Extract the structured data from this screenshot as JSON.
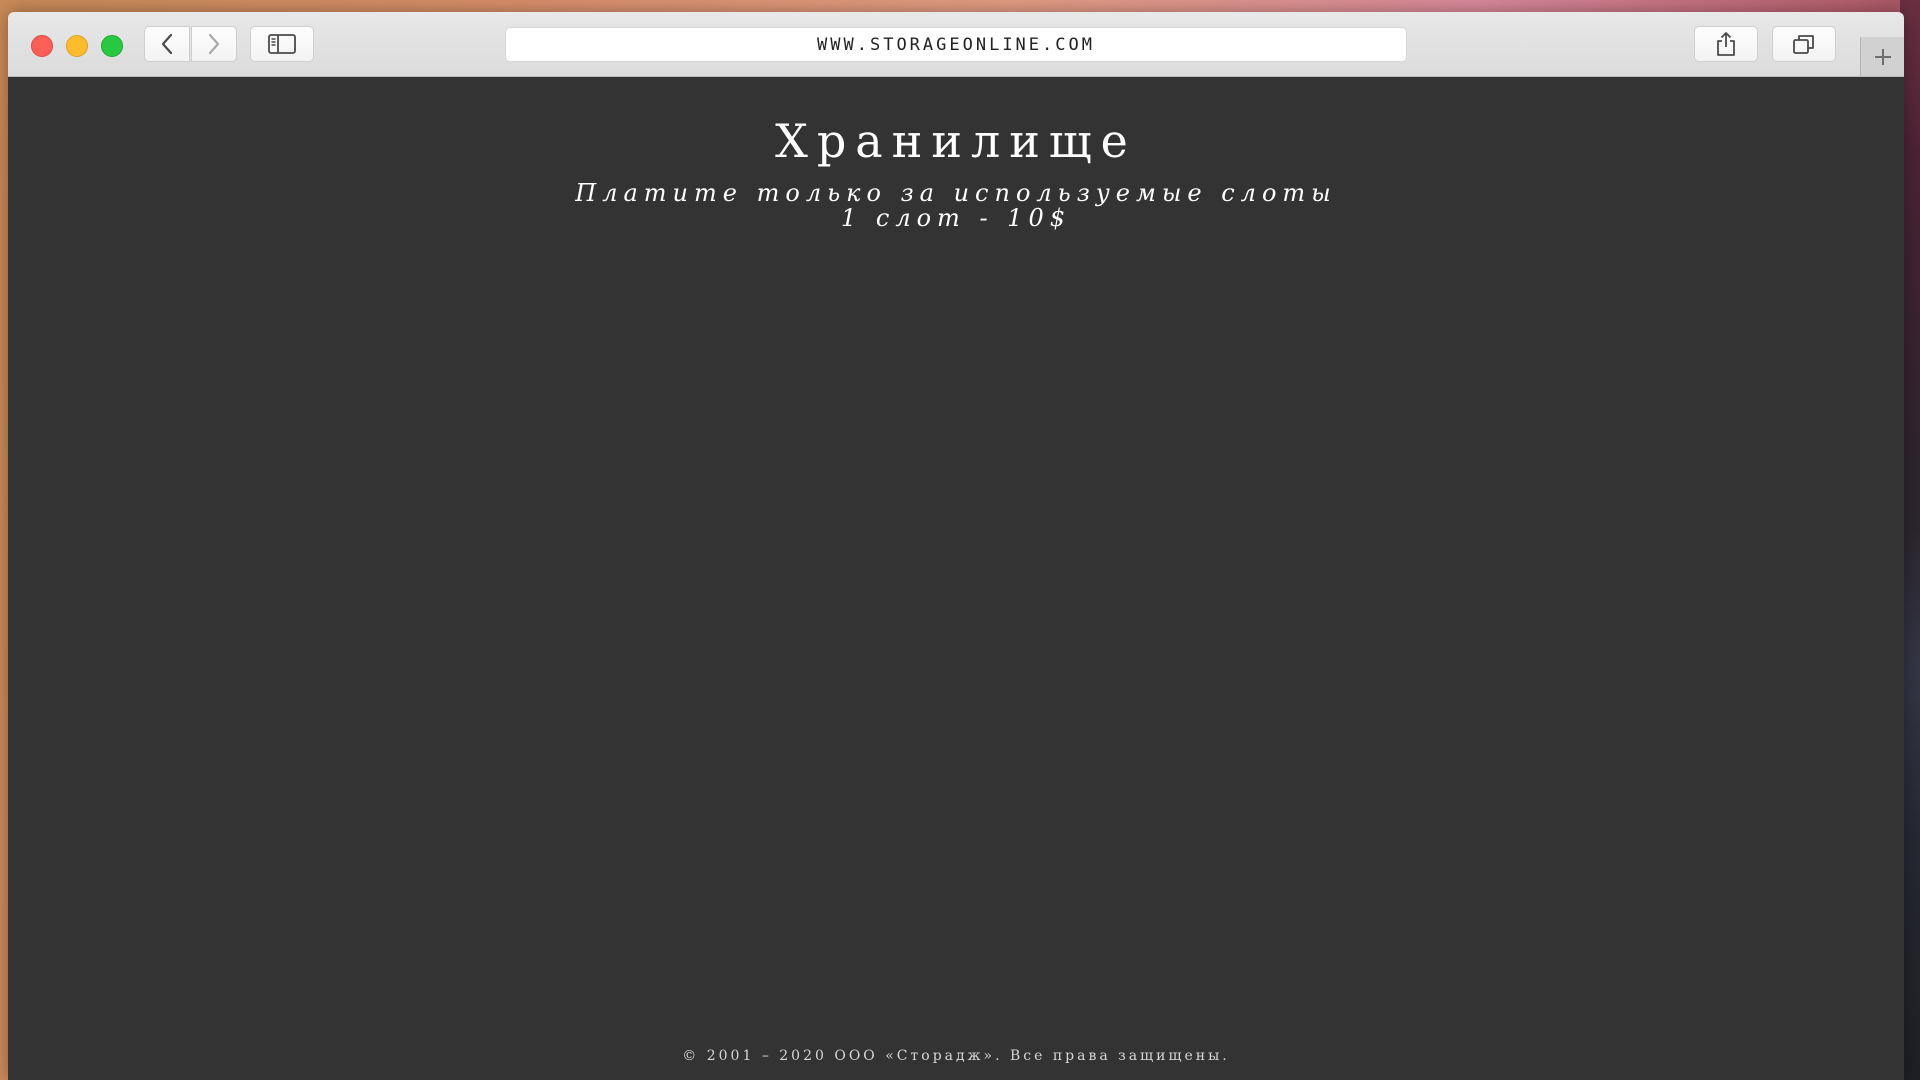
{
  "browser": {
    "url": "WWW.STORAGEONLINE.COM",
    "icons": {
      "close": "close-window-dot",
      "minimize": "minimize-window-dot",
      "maximize": "maximize-window-dot",
      "back": "chevron-left-icon",
      "forward": "chevron-right-icon",
      "sidebar": "sidebar-icon",
      "share": "share-icon",
      "tabs": "tabs-overview-icon",
      "new_tab": "plus-icon"
    },
    "colors": {
      "close": "#fc5f57",
      "minimize": "#fdbc2e",
      "maximize": "#28c840"
    }
  },
  "page": {
    "title": "Хранилище",
    "subtitle_line1": "Платите только за используемые слоты",
    "subtitle_line2": "1 слот - 10$",
    "footer": "© 2001 – 2020 ООО «Сторадж». Все права защищены.",
    "background_color": "#333333",
    "text_color": "#ffffff"
  }
}
